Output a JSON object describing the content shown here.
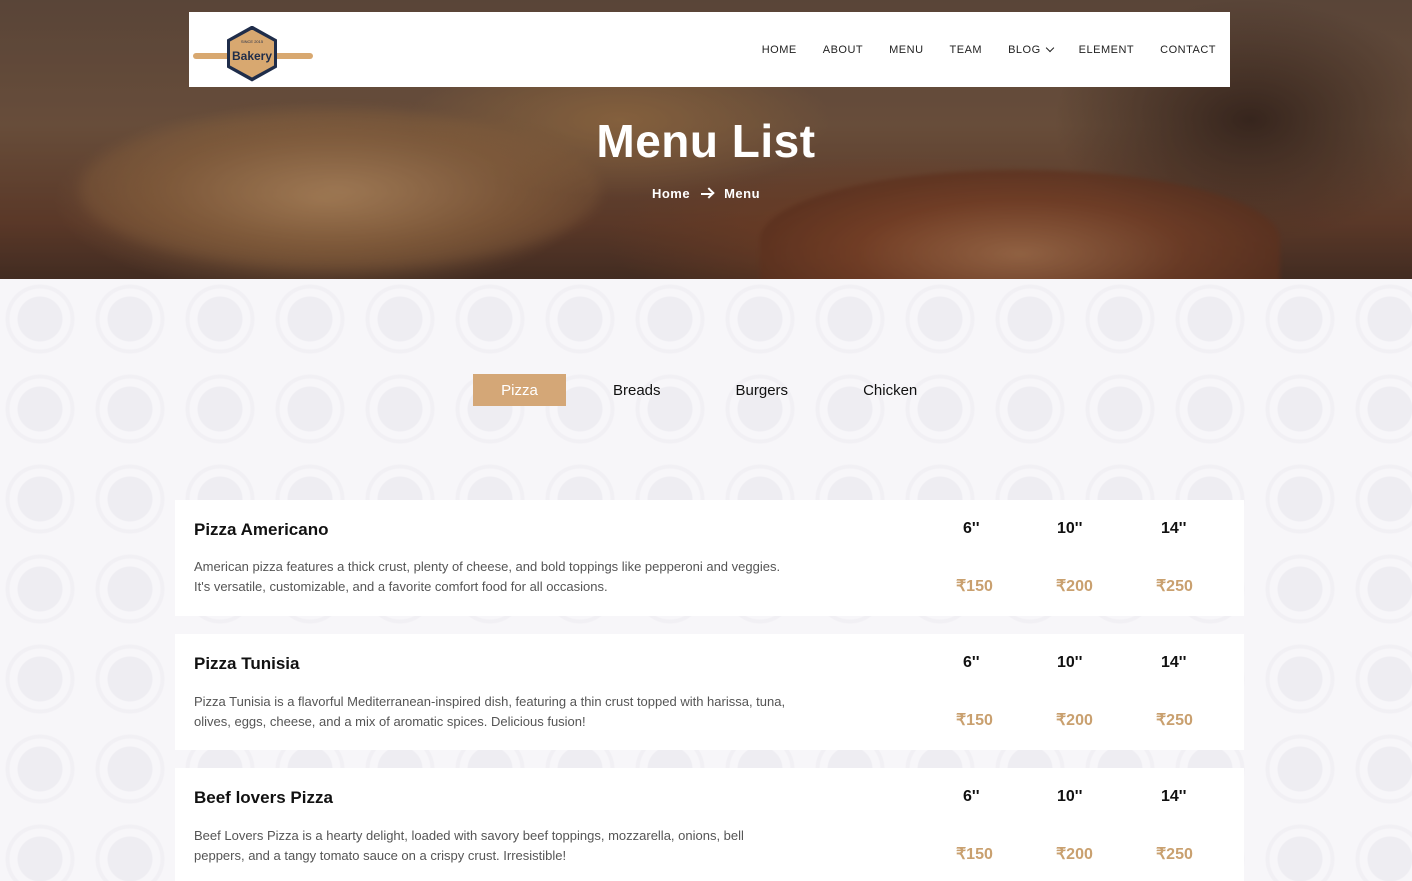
{
  "logo": {
    "text": "Bakery",
    "since": "SINCE 2015"
  },
  "nav": {
    "items": [
      "HOME",
      "ABOUT",
      "MENU",
      "TEAM",
      "BLOG",
      "ELEMENT",
      "CONTACT"
    ]
  },
  "hero": {
    "title": "Menu List",
    "breadcrumb": {
      "home": "Home",
      "current": "Menu"
    }
  },
  "tabs": [
    "Pizza",
    "Breads",
    "Burgers",
    "Chicken"
  ],
  "active_tab": "Pizza",
  "menu": [
    {
      "name": "Pizza Americano",
      "description_line1": "American pizza features a thick crust, plenty of cheese, and bold toppings like pepperoni and veggies.",
      "description_line2": "It's versatile, customizable, and a favorite comfort food for all occasions.",
      "sizes": [
        "6''",
        "10''",
        "14''"
      ],
      "prices": [
        "₹150",
        "₹200",
        "₹250"
      ]
    },
    {
      "name": "Pizza Tunisia",
      "description_line1": "Pizza Tunisia is a flavorful Mediterranean-inspired dish, featuring a thin crust topped with harissa, tuna,",
      "description_line2": "olives, eggs, cheese, and a mix of aromatic spices. Delicious fusion!",
      "sizes": [
        "6''",
        "10''",
        "14''"
      ],
      "prices": [
        "₹150",
        "₹200",
        "₹250"
      ]
    },
    {
      "name": "Beef lovers Pizza",
      "description_line1": "Beef Lovers Pizza is a hearty delight, loaded with savory beef toppings, mozzarella, onions, bell",
      "description_line2": "peppers, and a tangy tomato sauce on a crispy crust. Irresistible!",
      "sizes": [
        "6''",
        "10''",
        "14''"
      ],
      "prices": [
        "₹150",
        "₹200",
        "₹250"
      ]
    }
  ],
  "colors": {
    "accent": "#d4a777",
    "price": "#c9a06f",
    "logo_navy": "#1f2d4a"
  }
}
